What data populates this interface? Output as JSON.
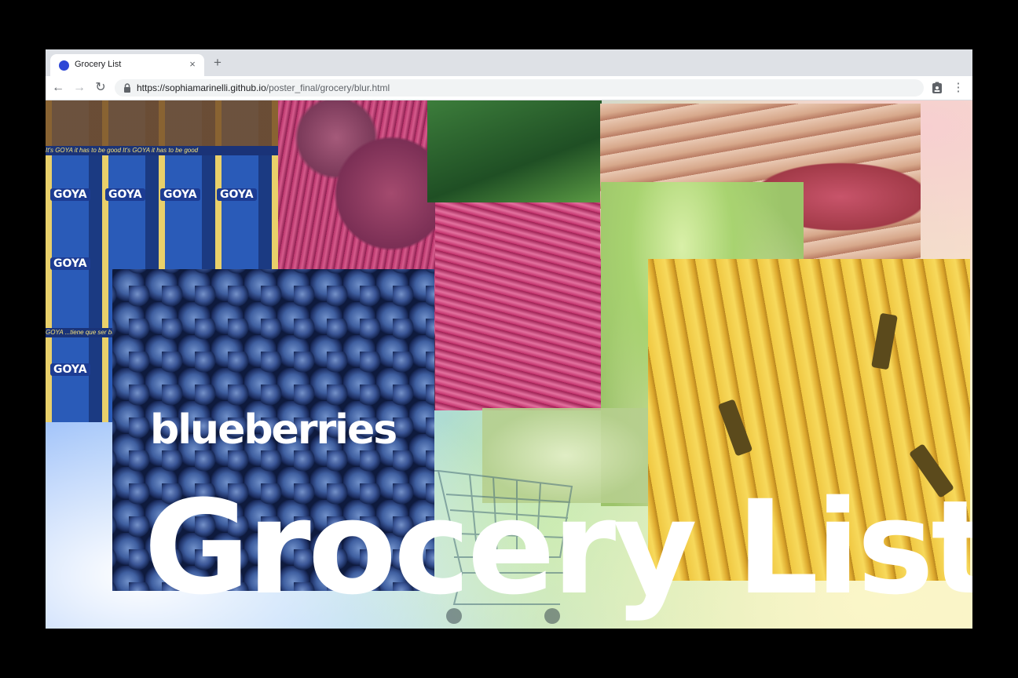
{
  "browser": {
    "tab": {
      "title": "Grocery List",
      "close_glyph": "×",
      "favicon_color": "#2d46d6"
    },
    "new_tab_glyph": "+",
    "nav": {
      "back_glyph": "←",
      "forward_glyph": "→",
      "reload_glyph": "↻"
    },
    "address": {
      "host": "https://sophiamarinelli.github.io",
      "path": "/poster_final/grocery/blur.html"
    },
    "menu_glyph": "⋮"
  },
  "page": {
    "collage": {
      "cans": {
        "brand": "GOYA",
        "shelf_text_1": "It's GOYA it has to be good It's GOYA it has to be good",
        "shelf_text_2": "GOYA ...tiene que ser bueno GOYA"
      },
      "blueberries_label": "blueberries"
    },
    "title": "Grocery List"
  },
  "colors": {
    "blue": "#2d46d6",
    "banana": "#f0c842",
    "beet": "#c2306b",
    "blueberry": "#1c2f66"
  }
}
